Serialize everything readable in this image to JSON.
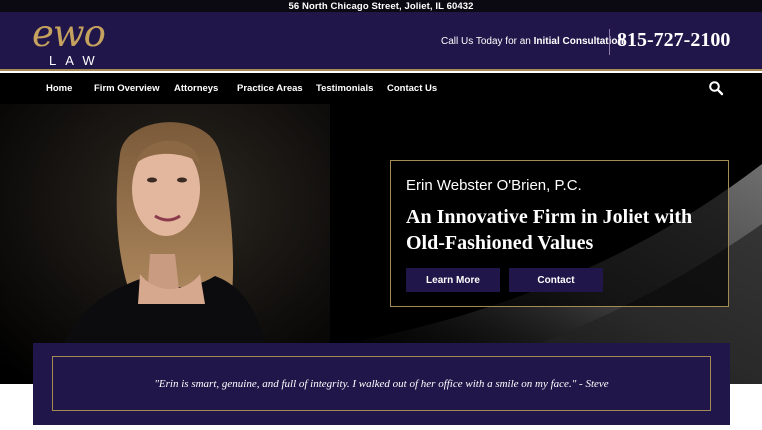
{
  "topbar": {
    "address": "56 North Chicago Street, Joliet, IL 60432"
  },
  "header": {
    "logo_mark": "ewo",
    "logo_sub": "LAW",
    "cta_prefix": "Call Us Today for an ",
    "cta_bold": "Initial Consultation",
    "phone": "815-727-2100"
  },
  "nav": {
    "items": [
      {
        "label": "Home"
      },
      {
        "label": "Firm Overview"
      },
      {
        "label": "Attorneys"
      },
      {
        "label": "Practice Areas"
      },
      {
        "label": "Testimonials"
      },
      {
        "label": "Contact Us"
      }
    ]
  },
  "hero": {
    "firm_name": "Erin Webster O'Brien, P.C.",
    "headline": "An Innovative Firm in Joliet with Old-Fashioned Values",
    "learn_more": "Learn More",
    "contact": "Contact"
  },
  "testimonial": {
    "quote": "\"Erin is smart, genuine, and full of integrity. I walked out of her office with a smile on my face.\" - Steve"
  },
  "colors": {
    "brand_purple": "#21164a",
    "accent_gold": "#a48a55",
    "logo_gold": "#c6a25f"
  },
  "icons": {
    "search": "search-icon"
  }
}
